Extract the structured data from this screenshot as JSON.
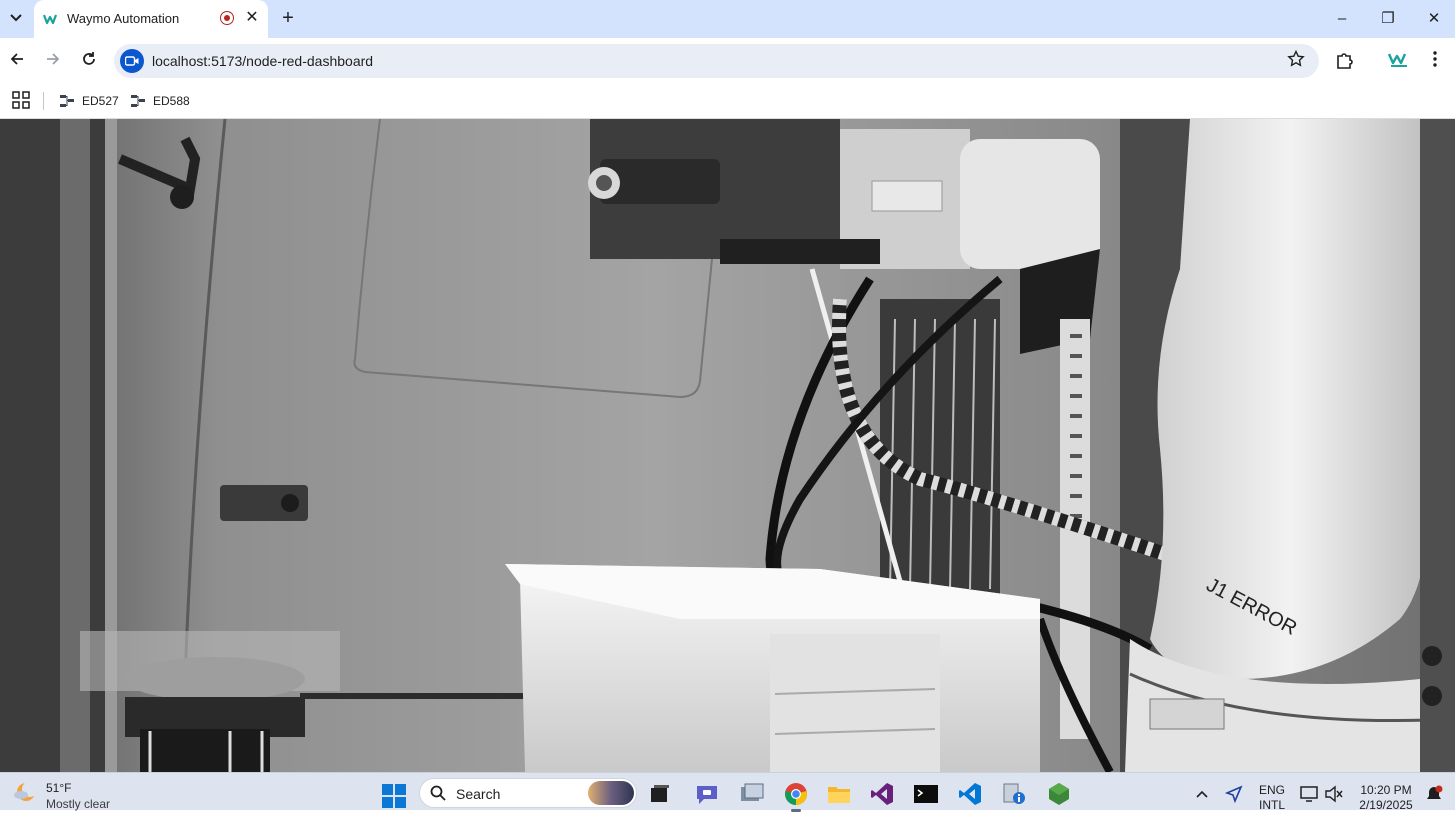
{
  "browser": {
    "tab": {
      "title": "Waymo Automation",
      "close_glyph": "✕"
    },
    "new_tab_glyph": "+",
    "window_controls": {
      "minimize": "–",
      "restore": "❐",
      "close": "✕"
    },
    "address": {
      "url": "localhost:5173/node-red-dashboard"
    },
    "bookmarks": [
      {
        "label": "ED527"
      },
      {
        "label": "ED588"
      }
    ]
  },
  "taskbar": {
    "weather": {
      "temp": "51°F",
      "condition": "Mostly clear"
    },
    "search": {
      "placeholder": "Search"
    },
    "tray": {
      "language": "ENG",
      "layout": "INTL",
      "time": "10:20 PM",
      "date": "2/19/2025"
    }
  },
  "icons": {
    "tab_list": "chevron-down-icon",
    "favicon": "waymo-logo-icon",
    "recording": "recording-icon",
    "back": "arrow-left-icon",
    "forward": "arrow-right-icon",
    "reload": "reload-icon",
    "site_info": "camera-icon",
    "bookmark_star": "star-icon",
    "extensions": "puzzle-icon",
    "profile": "waymo-profile-icon",
    "menu": "kebab-menu-icon"
  },
  "colors": {
    "tabstrip": "#d3e3fd",
    "omnibox": "#e9eef6",
    "accent": "#0b57d0",
    "taskbar": "#dde4ef"
  }
}
